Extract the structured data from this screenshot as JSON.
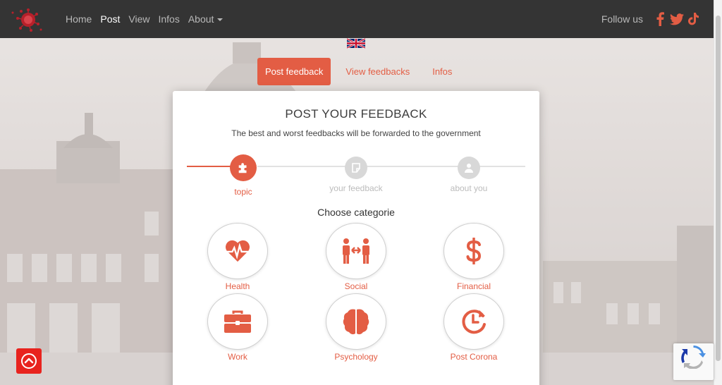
{
  "nav": {
    "links": [
      "Home",
      "Post",
      "View",
      "Infos",
      "About"
    ],
    "active": "Post",
    "follow_label": "Follow us",
    "social_icons": [
      "facebook-icon",
      "twitter-icon",
      "tiktok-icon"
    ]
  },
  "language_flag": "uk-flag-icon",
  "tabs": {
    "post": "Post feedback",
    "view": "View feedbacks",
    "infos": "Infos",
    "active": "post"
  },
  "card": {
    "title": "POST YOUR FEEDBACK",
    "subtitle": "The best and worst feedbacks will be forwarded to the government"
  },
  "wizard": {
    "steps": [
      {
        "label": "topic",
        "icon": "puzzle-icon",
        "state": "active"
      },
      {
        "label": "your feedback",
        "icon": "note-icon",
        "state": "inactive"
      },
      {
        "label": "about you",
        "icon": "user-icon",
        "state": "inactive"
      }
    ]
  },
  "categories": {
    "heading": "Choose categorie",
    "items": [
      {
        "label": "Health",
        "icon": "heartbeat-icon"
      },
      {
        "label": "Social",
        "icon": "people-icon"
      },
      {
        "label": "Financial",
        "icon": "dollar-icon"
      },
      {
        "label": "Work",
        "icon": "briefcase-icon"
      },
      {
        "label": "Psychology",
        "icon": "brain-icon"
      },
      {
        "label": "Post Corona",
        "icon": "clock-forward-icon"
      }
    ]
  },
  "colors": {
    "accent": "#e35d44",
    "navbar": "#343434",
    "totop": "#e8231e"
  }
}
